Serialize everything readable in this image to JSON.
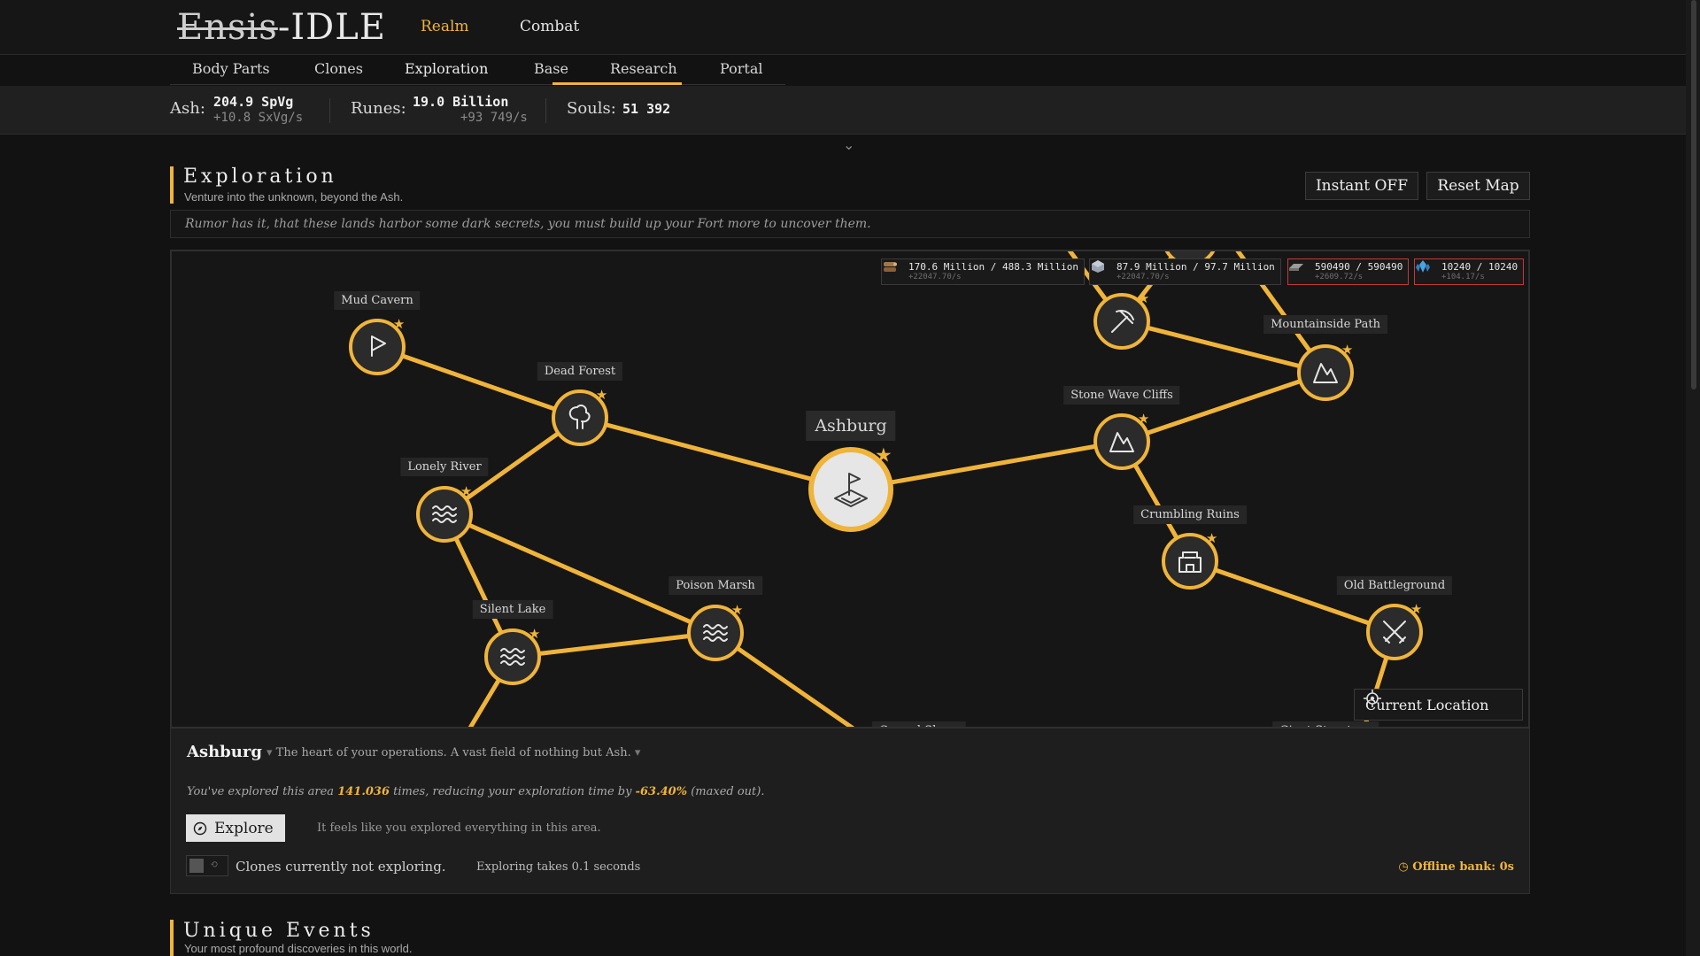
{
  "app": {
    "logo_strike": "Ensis",
    "logo_rest": "IDLE"
  },
  "modes": {
    "realm": "Realm",
    "combat": "Combat"
  },
  "subtabs": [
    "Body Parts",
    "Clones",
    "Exploration",
    "Base",
    "Research",
    "Portal"
  ],
  "active_subtab": "Exploration",
  "resources": {
    "ash": {
      "label": "Ash:",
      "value": "204.9 SpVg",
      "rate": "+10.8 SxVg/s"
    },
    "runes": {
      "label": "Runes:",
      "value": "19.0 Billion",
      "rate": "+93 749/s"
    },
    "souls": {
      "label": "Souls:",
      "value": "51 392"
    }
  },
  "exploration": {
    "title": "Exploration",
    "subtitle": "Venture into the unknown, beyond the Ash.",
    "instant_btn": "Instant OFF",
    "reset_btn": "Reset Map",
    "rumor": "Rumor has it, that these lands harbor some dark secrets, you must build up your Fort more to uncover them."
  },
  "map": {
    "chips": [
      {
        "value": "170.6 Million / 488.3 Million",
        "rate": "+22047.70/s",
        "icon": "wood-icon",
        "red": false
      },
      {
        "value": "87.9 Million / 97.7 Million",
        "rate": "+22047.70/s",
        "icon": "stone-icon",
        "red": false
      },
      {
        "value": "590490 / 590490",
        "rate": "+2609.72/s",
        "icon": "metal-icon",
        "red": true
      },
      {
        "value": "10240 / 10240",
        "rate": "+104.17/s",
        "icon": "crystal-icon",
        "red": true
      }
    ],
    "nodes": {
      "mud_cavern": "Mud Cavern",
      "dead_forest": "Dead Forest",
      "lonely_river": "Lonely River",
      "silent_lake": "Silent Lake",
      "poison_marsh": "Poison Marsh",
      "ashburg": "Ashburg",
      "stone_wave_cliffs": "Stone Wave Cliffs",
      "mountainside_path": "Mountainside Path",
      "crumbling_ruins": "Crumbling Ruins",
      "old_battleground": "Old Battleground",
      "cursed_shore": "Cursed Shore",
      "giant_structure": "Giant Structure"
    },
    "current_location_btn": "Current Location"
  },
  "detail": {
    "name": "Ashburg",
    "desc": "The heart of your operations. A vast field of nothing but Ash.",
    "stats_pre": "You've explored this area",
    "explored_count": "141.036",
    "stats_mid": "times, reducing your exploration time by",
    "reduction": "-63.40%",
    "stats_post": "(maxed out).",
    "explore_btn": "Explore",
    "note": "It feels like you explored everything in this area.",
    "clones": "Clones currently not exploring.",
    "time": "Exploring takes 0.1 seconds",
    "offline": "Offline bank: 0s"
  },
  "unique_events": {
    "title": "Unique Events",
    "subtitle": "Your most profound discoveries in this world."
  },
  "colors": {
    "accent": "#f0b43a",
    "bg": "#121212",
    "danger": "#c23a3a"
  }
}
